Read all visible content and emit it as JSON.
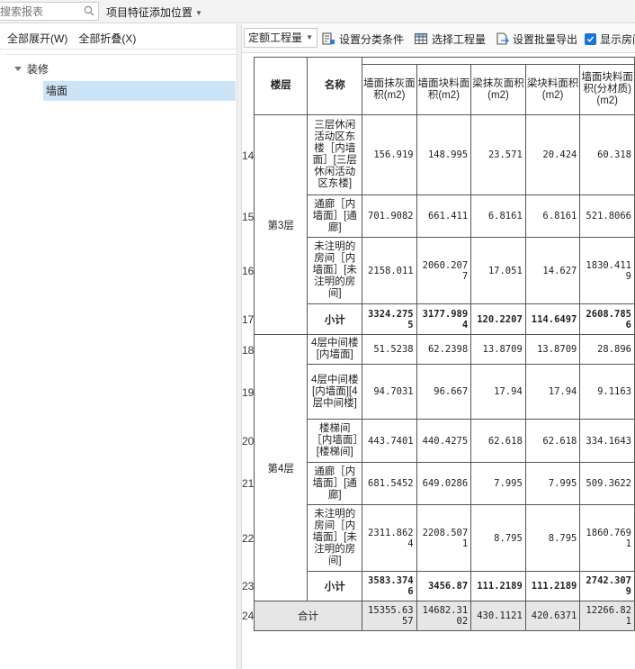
{
  "topbar": {
    "search_placeholder": "搜索报表",
    "project_position": "项目特征添加位置"
  },
  "left_panel": {
    "expand_all": "全部展开(W)",
    "collapse_all": "全部折叠(X)",
    "tree": {
      "root": "装修",
      "child": "墙面"
    }
  },
  "toolbar": {
    "quantity_type": "定额工程量",
    "set_category": "设置分类条件",
    "select_quantity": "选择工程量",
    "set_batch_export": "设置批量导出",
    "show_rooms": "显示房间"
  },
  "table": {
    "headers": {
      "floor": "楼层",
      "name": "名称",
      "c1": "墙面抹灰面积(m2)",
      "c2": "墙面块料面积(m2)",
      "c3": "梁抹灰面积(m2)",
      "c4": "梁块料面积(m2)",
      "c5": "墙面块料面积(分材质)(m2)"
    },
    "floors": [
      {
        "floor": "第3层",
        "rows": [
          {
            "num": "14",
            "name": "三层休闲活动区东楼［内墙面］[三层休闲活动区东楼]",
            "c1": "156.919",
            "c2": "148.995",
            "c3": "23.571",
            "c4": "20.424",
            "c5": "60.318"
          },
          {
            "num": "15",
            "name": "通廊［内墙面］[通廊]",
            "c1": "701.9082",
            "c2": "661.411",
            "c3": "6.8161",
            "c4": "6.8161",
            "c5": "521.8066"
          },
          {
            "num": "16",
            "name": "未注明的房间［内墙面］[未注明的房间]",
            "c1": "2158.011",
            "c2": "2060.2077",
            "c3": "17.051",
            "c4": "14.627",
            "c5": "1830.4119"
          }
        ],
        "subtotal": {
          "num": "17",
          "label": "小计",
          "c1": "3324.2755",
          "c2": "3177.9894",
          "c3": "120.2207",
          "c4": "114.6497",
          "c5": "2608.7856"
        }
      },
      {
        "floor": "第4层",
        "rows": [
          {
            "num": "18",
            "name": "4层中间楼[内墙面]",
            "c1": "51.5238",
            "c2": "62.2398",
            "c3": "13.8709",
            "c4": "13.8709",
            "c5": "28.896"
          },
          {
            "num": "19",
            "name": "4层中间楼[内墙面][4层中间楼]",
            "c1": "94.7031",
            "c2": "96.667",
            "c3": "17.94",
            "c4": "17.94",
            "c5": "9.1163"
          },
          {
            "num": "20",
            "name": "楼梯间［内墙面］[楼梯间]",
            "c1": "443.7401",
            "c2": "440.4275",
            "c3": "62.618",
            "c4": "62.618",
            "c5": "334.1643"
          },
          {
            "num": "21",
            "name": "通廊［内墙面］[通廊]",
            "c1": "681.5452",
            "c2": "649.0286",
            "c3": "7.995",
            "c4": "7.995",
            "c5": "509.3622"
          },
          {
            "num": "22",
            "name": "未注明的房间［内墙面］[未注明的房间]",
            "c1": "2311.8624",
            "c2": "2208.5071",
            "c3": "8.795",
            "c4": "8.795",
            "c5": "1860.7691"
          }
        ],
        "subtotal": {
          "num": "23",
          "label": "小计",
          "c1": "3583.3746",
          "c2": "3456.87",
          "c3": "111.2189",
          "c4": "111.2189",
          "c5": "2742.3079"
        }
      }
    ],
    "total": {
      "num": "24",
      "label": "合计",
      "c1": "15355.6357",
      "c2": "14682.3102",
      "c3": "430.1121",
      "c4": "420.6371",
      "c5": "12266.821"
    }
  }
}
